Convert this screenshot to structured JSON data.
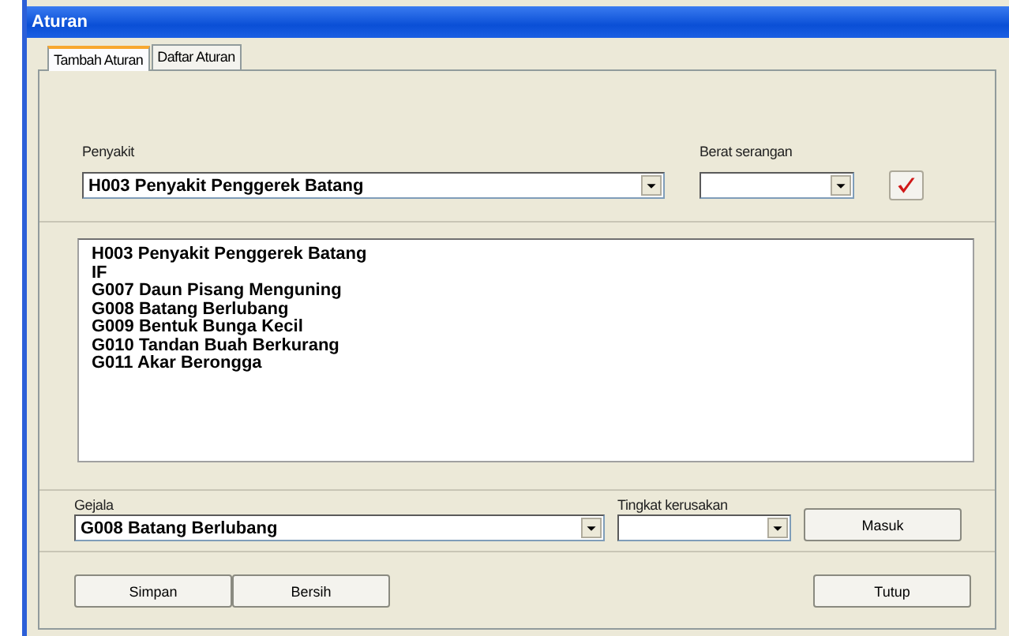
{
  "window": {
    "title": "Aturan"
  },
  "tabs": [
    {
      "label": "Tambah Aturan",
      "selected": true
    },
    {
      "label": "Daftar Aturan",
      "selected": false
    }
  ],
  "penyakit": {
    "label": "Penyakit",
    "value": "H003 Penyakit Penggerek Batang"
  },
  "berat_serangan": {
    "label": "Berat serangan"
  },
  "rule_lines": [
    "H003 Penyakit Penggerek Batang",
    "IF",
    "G007 Daun Pisang Menguning",
    "G008 Batang Berlubang",
    "G009 Bentuk Bunga Kecil",
    "G010 Tandan Buah Berkurang",
    "G011 Akar Berongga"
  ],
  "gejala": {
    "label": "Gejala",
    "value": "G008 Batang Berlubang"
  },
  "tingkat_kerusakan": {
    "label": "Tingkat kerusakan"
  },
  "masuk_button": "Masuk",
  "bottom_buttons": [
    "Simpan",
    "Bersih"
  ],
  "close_button": "Tutup"
}
